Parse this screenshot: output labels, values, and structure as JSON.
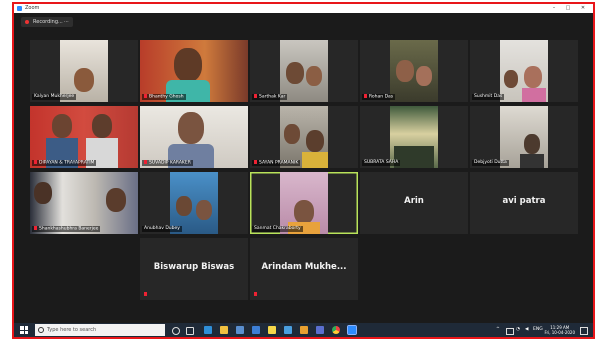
{
  "window": {
    "title": "Zoom",
    "minimize": "–",
    "maximize": "□",
    "close": "✕"
  },
  "recording": {
    "label": "Recording...",
    "more": "⋯"
  },
  "participants": [
    {
      "name": "Kalyan Mukherjee"
    },
    {
      "name": "Bhanthy Ghosh"
    },
    {
      "name": "Sarthak Kar"
    },
    {
      "name": "Rohan Das"
    },
    {
      "name": "Sushmit Das"
    },
    {
      "name": "DIPAYAN & TRAYAPRATIM"
    },
    {
      "name": "SUVADIP KARAKER"
    },
    {
      "name": "SAYAN PRAMANIK"
    },
    {
      "name": "SUBRATA SAHA"
    },
    {
      "name": "Debjyoti Dutta"
    },
    {
      "name": "Shankhashubhra Banerjee"
    },
    {
      "name": "Anubhav Dubey"
    },
    {
      "name": "Sanmat Chakraborty"
    },
    {
      "name": "Arin"
    },
    {
      "name": "avi patra"
    },
    {
      "name": "Biswarup Biswas"
    },
    {
      "name": "Arindam Mukhe..."
    }
  ],
  "taskbar": {
    "search_placeholder": "Type here to search",
    "lang": "ENG",
    "time": "11:29 AM",
    "date": "Fri, 10-04-2020",
    "icons": [
      "task-view-icon",
      "edge-icon",
      "file-explorer-icon",
      "store-icon",
      "mail-icon",
      "sticky-notes-icon",
      "photos-icon",
      "chrome-icon",
      "zoom-icon"
    ]
  },
  "colors": {
    "border": "#e8161a",
    "active_speaker": "#b9e35a",
    "mute": "#e22233",
    "tile_bg": "#272727",
    "stage_bg": "#1b1b1b"
  }
}
